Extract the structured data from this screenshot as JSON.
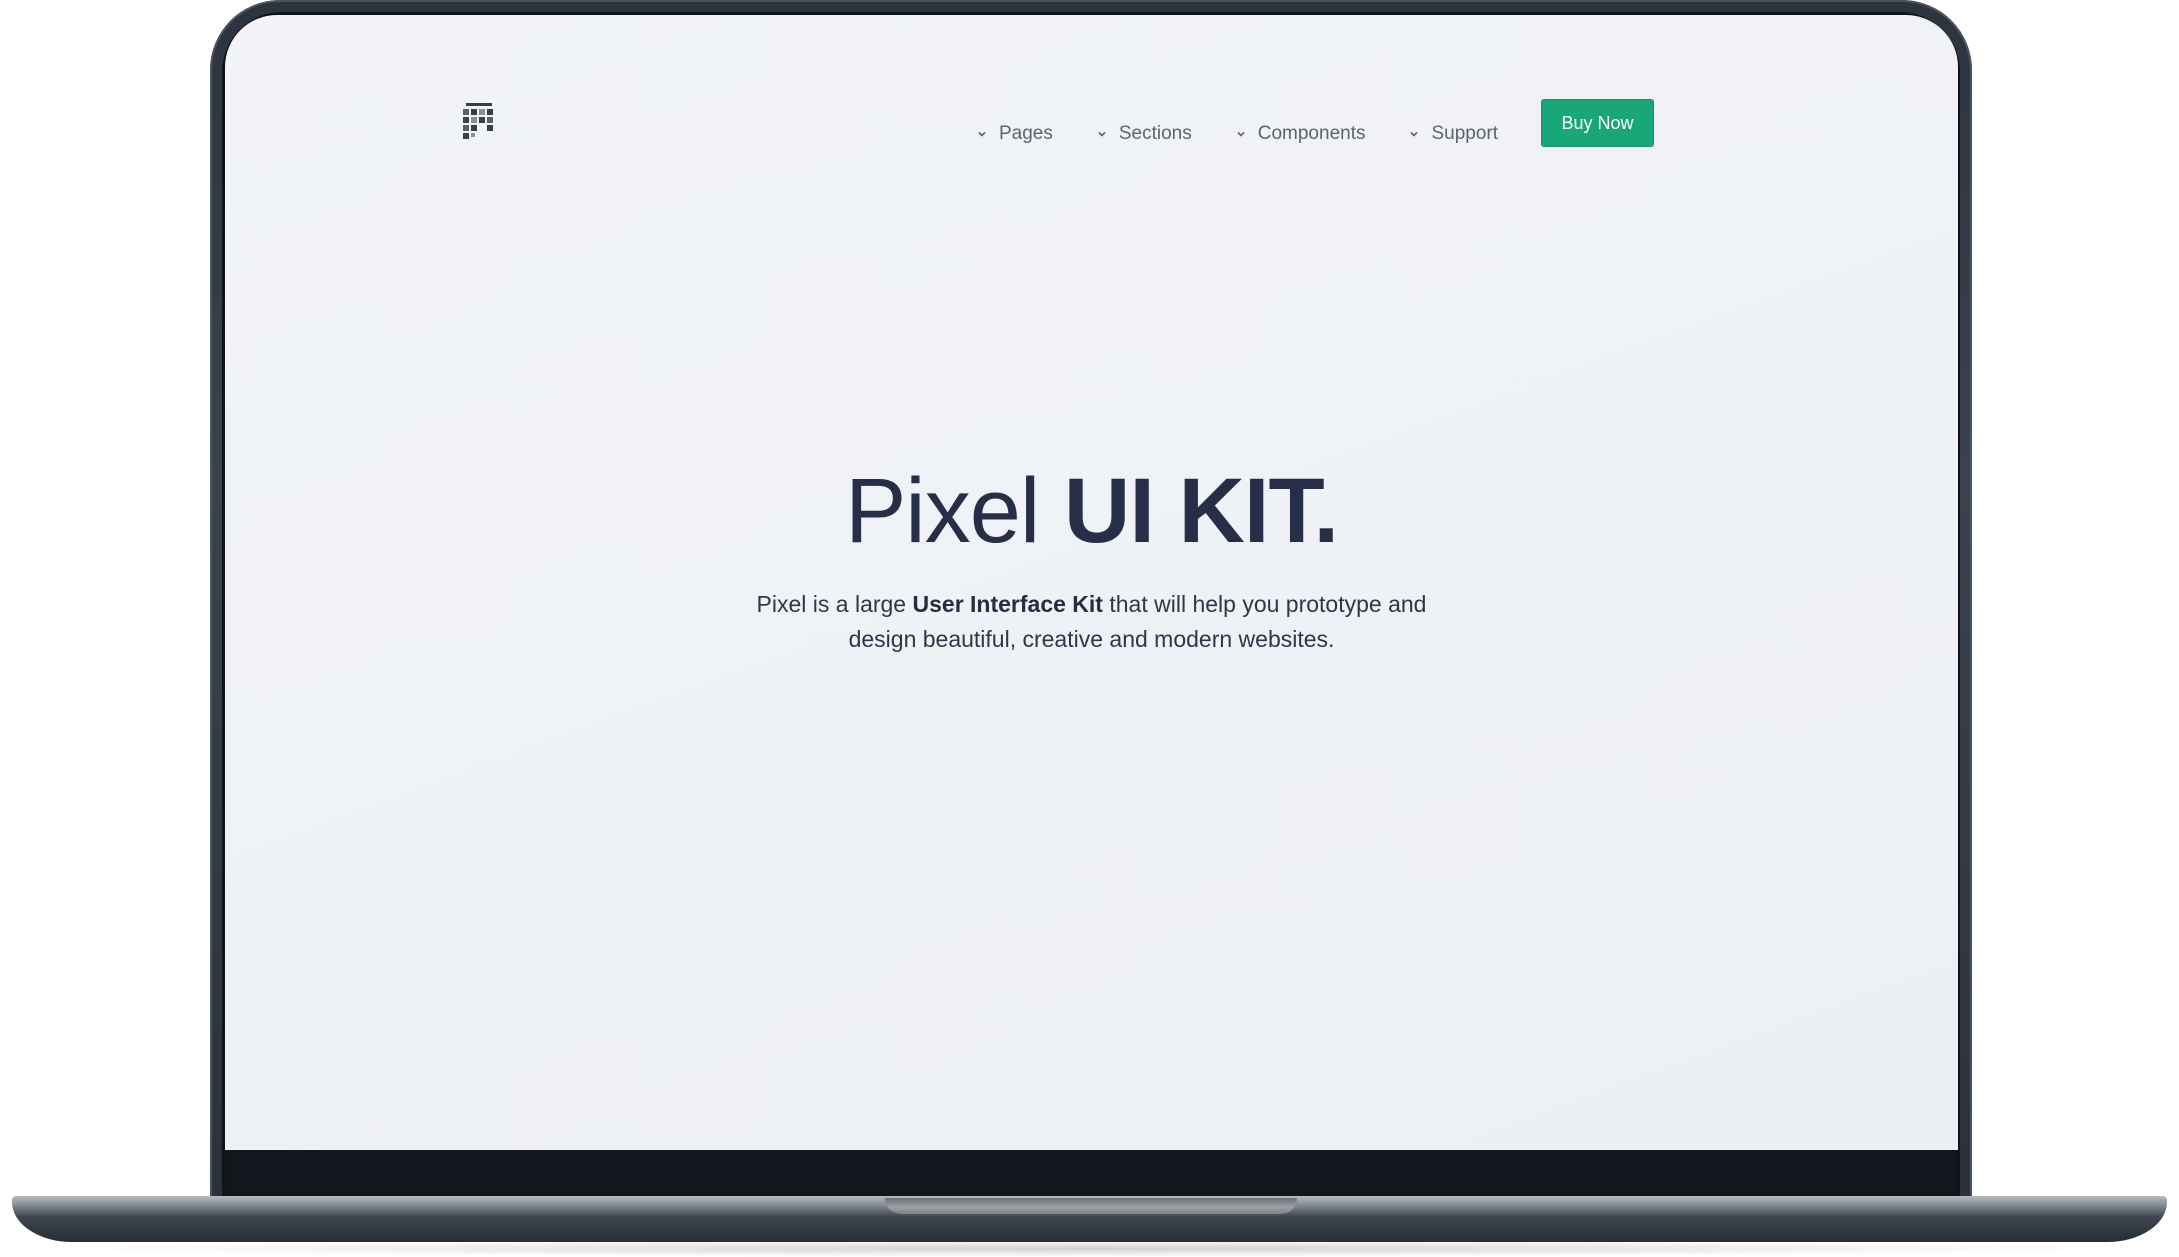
{
  "nav": {
    "logo_icon": "pixel-logo-icon",
    "items": [
      {
        "label": "Pages",
        "icon": "chevron-down-icon"
      },
      {
        "label": "Sections",
        "icon": "chevron-down-icon"
      },
      {
        "label": "Components",
        "icon": "chevron-down-icon"
      },
      {
        "label": "Support",
        "icon": "chevron-down-icon"
      }
    ],
    "cta_label": "Buy Now"
  },
  "hero": {
    "title_light": "Pixel",
    "title_bold": "UI KIT.",
    "subtitle_pre": "Pixel is a large",
    "subtitle_bold": "User Interface Kit",
    "subtitle_post_line1": "that will help you prototype and",
    "subtitle_line2": "design beautiful, creative and modern websites."
  },
  "colors": {
    "accent": "#19a678",
    "heading": "#262f47",
    "nav_text": "#5a6470",
    "screen_bg": "#eff2f5",
    "device_frame": "#2c343d"
  }
}
